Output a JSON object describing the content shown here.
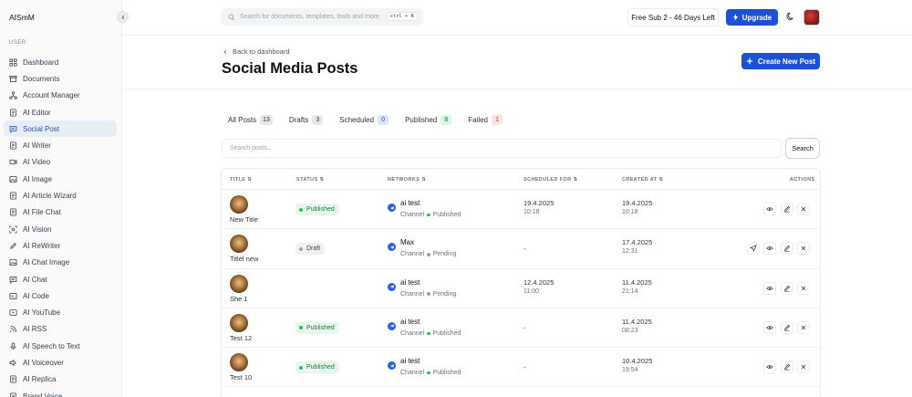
{
  "app": {
    "brand": "AISmM"
  },
  "sidebar": {
    "section_label": "USER",
    "items": [
      {
        "label": "Dashboard",
        "icon": "grid-icon"
      },
      {
        "label": "Documents",
        "icon": "archive-icon"
      },
      {
        "label": "Account Manager",
        "icon": "network-icon"
      },
      {
        "label": "AI Editor",
        "icon": "document-icon"
      },
      {
        "label": "Social Post",
        "icon": "chat-bubble-icon"
      },
      {
        "label": "AI Writer",
        "icon": "document-icon"
      },
      {
        "label": "AI Video",
        "icon": "video-icon"
      },
      {
        "label": "AI Image",
        "icon": "image-icon"
      },
      {
        "label": "AI Article Wizard",
        "icon": "document-icon"
      },
      {
        "label": "AI File Chat",
        "icon": "document-icon"
      },
      {
        "label": "AI Vision",
        "icon": "scan-icon"
      },
      {
        "label": "AI ReWriter",
        "icon": "pen-icon"
      },
      {
        "label": "AI Chat Image",
        "icon": "image-icon"
      },
      {
        "label": "AI Chat",
        "icon": "chat-bubble-icon"
      },
      {
        "label": "AI Code",
        "icon": "terminal-icon"
      },
      {
        "label": "AI YouTube",
        "icon": "play-icon"
      },
      {
        "label": "AI RSS",
        "icon": "rss-icon"
      },
      {
        "label": "AI Speech to Text",
        "icon": "microphone-icon"
      },
      {
        "label": "AI Voiceover",
        "icon": "speaker-icon"
      },
      {
        "label": "AI Replica",
        "icon": "document-icon"
      },
      {
        "label": "Brand Voice",
        "icon": "document-icon"
      }
    ]
  },
  "topbar": {
    "search_placeholder": "Search for documents, templates, tools and more",
    "shortcut": "ctrl + K",
    "plan": "Free Sub 2 - 46 Days Left",
    "upgrade": "Upgrade"
  },
  "header": {
    "back": "Back to dashboard",
    "title": "Social Media Posts",
    "create": "Create New Post"
  },
  "tabs": [
    {
      "label": "All Posts",
      "count": "13"
    },
    {
      "label": "Drafts",
      "count": "3"
    },
    {
      "label": "Scheduled",
      "count": "0"
    },
    {
      "label": "Published",
      "count": "8"
    },
    {
      "label": "Failed",
      "count": "1"
    }
  ],
  "search": {
    "placeholder": "Search posts...",
    "button": "Search"
  },
  "table": {
    "headers": {
      "title": "TITLE",
      "status": "STATUS",
      "networks": "NETWORKS",
      "scheduled": "SCHEDULED FOR",
      "created": "CREATED AT",
      "actions": "ACTIONS"
    },
    "rows": [
      {
        "title": "New Title",
        "status": "Published",
        "network": "ai test",
        "channel": "Channel",
        "net_status": "Published",
        "sched_date": "19.4.2025",
        "sched_time": "10:18",
        "created_date": "19.4.2025",
        "created_time": "10:18",
        "send": false
      },
      {
        "title": "Titlel new",
        "status": "Draft",
        "network": "Max",
        "channel": "Channel",
        "net_status": "Pending",
        "sched_date": "-",
        "sched_time": "",
        "created_date": "17.4.2025",
        "created_time": "12:31",
        "send": true
      },
      {
        "title": "She 1",
        "status": "",
        "network": "ai test",
        "channel": "Channel",
        "net_status": "Pending",
        "sched_date": "12.4.2025",
        "sched_time": "11:00",
        "created_date": "11.4.2025",
        "created_time": "21:14",
        "send": false
      },
      {
        "title": "Test 12",
        "status": "Published",
        "network": "ai test",
        "channel": "Channel",
        "net_status": "Published",
        "sched_date": "-",
        "sched_time": "",
        "created_date": "11.4.2025",
        "created_time": "08:23",
        "send": false
      },
      {
        "title": "Test 10",
        "status": "Published",
        "network": "ai test",
        "channel": "Channel",
        "net_status": "Published",
        "sched_date": "-",
        "sched_time": "",
        "created_date": "10.4.2025",
        "created_time": "19:54",
        "send": false
      }
    ]
  },
  "colors": {
    "accent": "#1e4fd8",
    "published_bg": "#e8f7ee",
    "published_fg": "#15803d",
    "draft_bg": "#f1f1f1",
    "draft_fg": "#374151",
    "pending_dot": "#9ca3af",
    "published_dot": "#22c55e"
  }
}
